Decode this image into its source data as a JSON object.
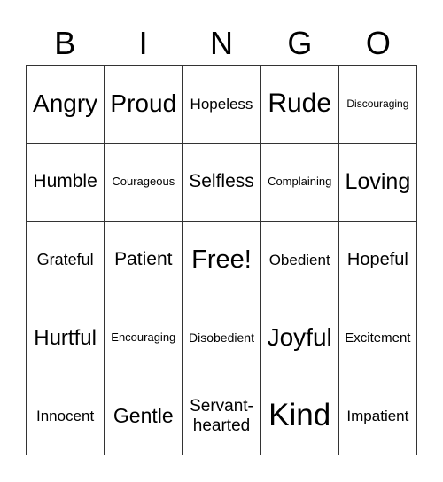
{
  "header": [
    "B",
    "I",
    "N",
    "G",
    "O"
  ],
  "cells": [
    "Angry",
    "Proud",
    "Hopeless",
    "Rude",
    "Discouraging",
    "Humble",
    "Courageous",
    "Selfless",
    "Complaining",
    "Loving",
    "Grateful",
    "Patient",
    "Free!",
    "Obedient",
    "Hopeful",
    "Hurtful",
    "Encouraging",
    "Disobedient",
    "Joyful",
    "Excitement",
    "Innocent",
    "Gentle",
    "Servant-hearted",
    "Kind",
    "Impatient"
  ]
}
